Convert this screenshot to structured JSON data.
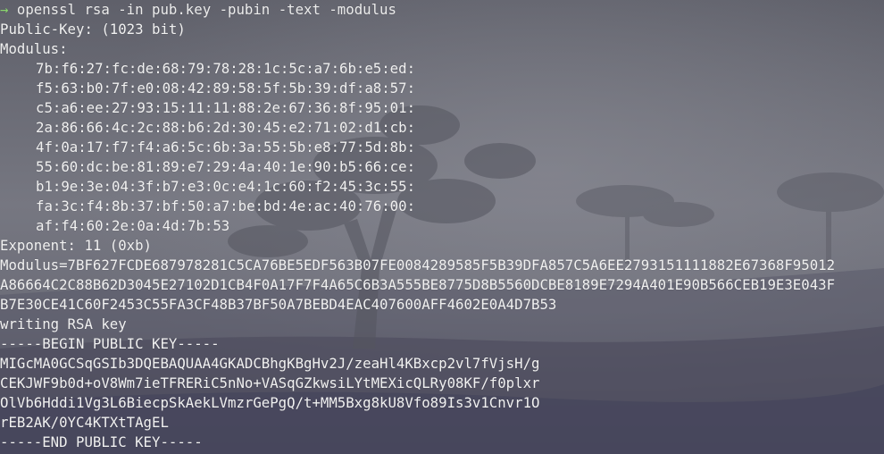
{
  "terminal": {
    "prompt": {
      "arrow": "→",
      "command": "openssl rsa -in pub.key -pubin -text -modulus"
    },
    "public_key_header": "Public-Key: (1023 bit)",
    "modulus_label": "Modulus:",
    "modulus_hex_lines": [
      "7b:f6:27:fc:de:68:79:78:28:1c:5c:a7:6b:e5:ed:",
      "f5:63:b0:7f:e0:08:42:89:58:5f:5b:39:df:a8:57:",
      "c5:a6:ee:27:93:15:11:11:88:2e:67:36:8f:95:01:",
      "2a:86:66:4c:2c:88:b6:2d:30:45:e2:71:02:d1:cb:",
      "4f:0a:17:f7:f4:a6:5c:6b:3a:55:5b:e8:77:5d:8b:",
      "55:60:dc:be:81:89:e7:29:4a:40:1e:90:b5:66:ce:",
      "b1:9e:3e:04:3f:b7:e3:0c:e4:1c:60:f2:45:3c:55:",
      "fa:3c:f4:8b:37:bf:50:a7:be:bd:4e:ac:40:76:00:",
      "af:f4:60:2e:0a:4d:7b:53"
    ],
    "exponent": "Exponent: 11 (0xb)",
    "modulus_full_lines": [
      "Modulus=7BF627FCDE687978281C5CA76BE5EDF563B07FE0084289585F5B39DFA857C5A6EE2793151111882E67368F95012",
      "A86664C2C88B62D3045E27102D1CB4F0A17F7F4A65C6B3A555BE8775D8B5560DCBE8189E7294A401E90B566CEB19E3E043F",
      "B7E30CE41C60F2453C55FA3CF48B37BF50A7BEBD4EAC407600AFF4602E0A4D7B53"
    ],
    "writing": "writing RSA key",
    "pem_begin": "-----BEGIN PUBLIC KEY-----",
    "pem_lines": [
      "MIGcMA0GCSqGSIb3DQEBAQUAA4GKADCBhgKBgHv2J/zeaHl4KBxcp2vl7fVjsH/g",
      "CEKJWF9b0d+oV8Wm7ieTFRERiC5nNo+VASqGZkwsiLYtMEXicQLRy08KF/f0plxr",
      "OlVb6Hddi1Vg3L6BiecpSkAekLVmzrGePgQ/t+MM5Bxg8kU8Vfo89Is3v1Cnvr1O",
      "rEB2AK/0YC4KTXtTAgEL"
    ],
    "pem_end": "-----END PUBLIC KEY-----"
  },
  "colors": {
    "text": "#f1f1f1",
    "prompt_arrow": "#8bd66f",
    "background": "#6f7079"
  }
}
